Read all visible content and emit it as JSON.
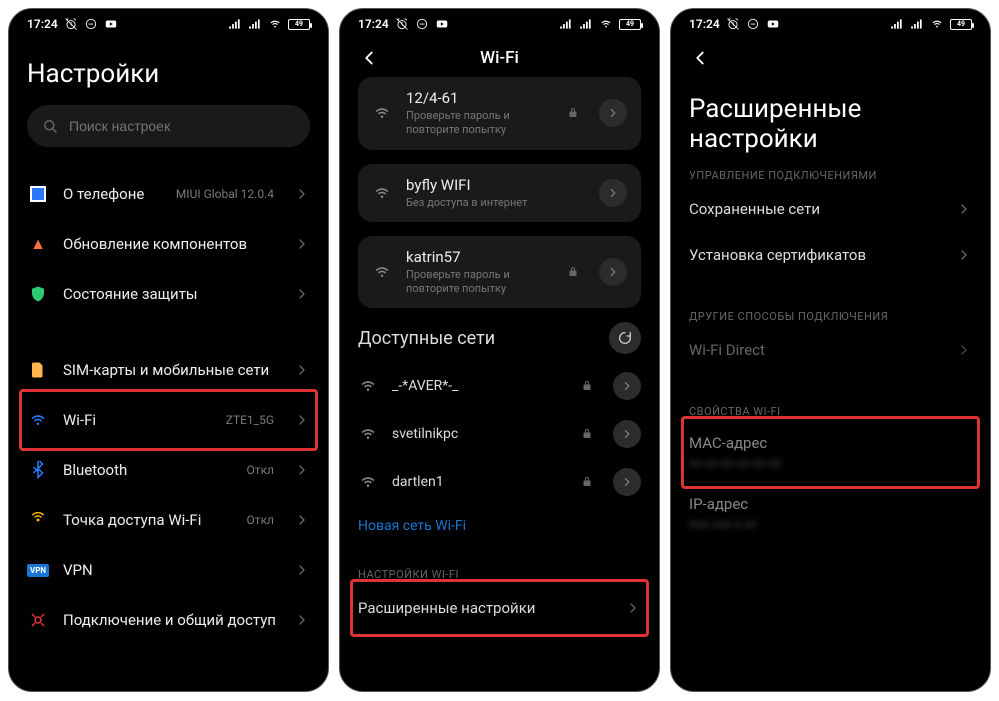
{
  "statusbar": {
    "time": "17:24",
    "battery": "49"
  },
  "screen1": {
    "title": "Настройки",
    "search_placeholder": "Поиск настроек",
    "items": {
      "about": {
        "label": "О телефоне",
        "value": "MIUI Global 12.0.4"
      },
      "update": {
        "label": "Обновление компонентов"
      },
      "security": {
        "label": "Состояние защиты"
      },
      "sim": {
        "label": "SIM-карты и мобильные сети"
      },
      "wifi": {
        "label": "Wi-Fi",
        "value": "ZTE1_5G"
      },
      "bluetooth": {
        "label": "Bluetooth",
        "value": "Откл"
      },
      "hotspot": {
        "label": "Точка доступа Wi-Fi",
        "value": "Откл"
      },
      "vpn": {
        "label": "VPN"
      },
      "share": {
        "label": "Подключение и общий доступ"
      }
    }
  },
  "screen2": {
    "title": "Wi-Fi",
    "saved": [
      {
        "name": "12/4-61",
        "desc": "Проверьте пароль и повторите попытку",
        "locked": true
      },
      {
        "name": "byfly WIFI",
        "desc": "Без доступа в интернет",
        "locked": false
      },
      {
        "name": "katrin57",
        "desc": "Проверьте пароль и повторите попытку",
        "locked": true
      }
    ],
    "available_label": "Доступные сети",
    "available": [
      {
        "name": "_-*AVER*-_",
        "locked": true
      },
      {
        "name": "svetilnikpc",
        "locked": true
      },
      {
        "name": "dartlen1",
        "locked": true
      }
    ],
    "new_network": "Новая сеть Wi-Fi",
    "settings_caption": "НАСТРОЙКИ WI-FI",
    "advanced": "Расширенные настройки"
  },
  "screen3": {
    "title": "Расширенные настройки",
    "conn_caption": "УПРАВЛЕНИЕ ПОДКЛЮЧЕНИЯМИ",
    "saved_nets": "Сохраненные сети",
    "install_cert": "Установка сертификатов",
    "other_caption": "ДРУГИЕ СПОСОБЫ ПОДКЛЮЧЕНИЯ",
    "wifi_direct": "Wi-Fi Direct",
    "props_caption": "СВОЙСТВА WI-FI",
    "mac": {
      "label": "MAC-адрес",
      "value": "xx:xx:xx:xx:xx:xx"
    },
    "ip": {
      "label": "IP-адрес",
      "value": "xxx.xxx.x.xx"
    }
  }
}
